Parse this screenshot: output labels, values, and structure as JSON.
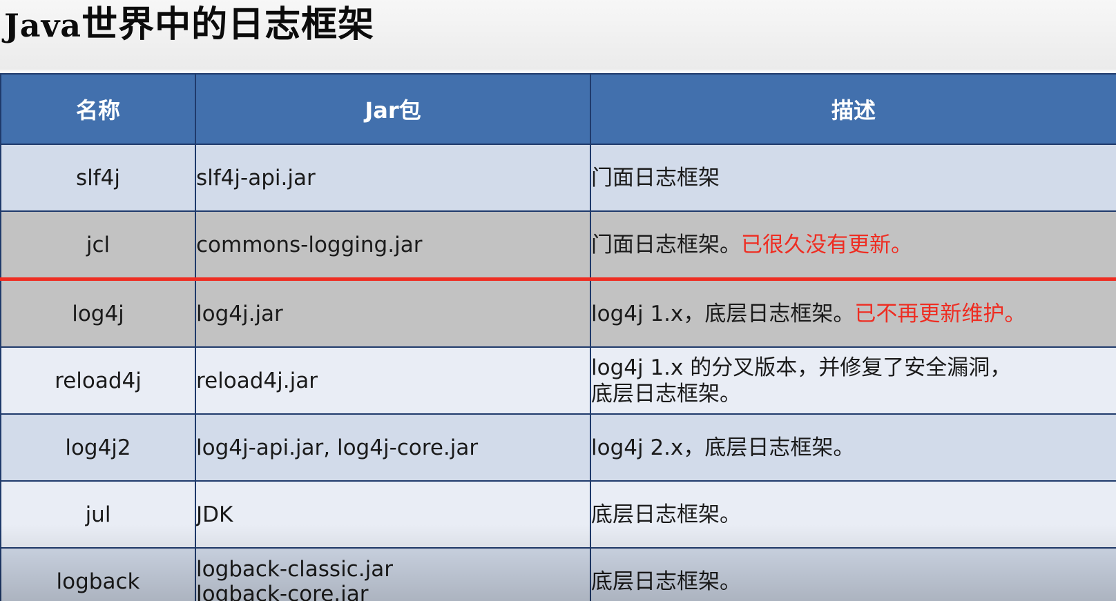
{
  "title": {
    "latin": "Java",
    "cjk": "世界中的日志框架"
  },
  "header": {
    "col_name": "名称",
    "col_jar": "Jar包",
    "col_desc": "描述"
  },
  "rows": [
    {
      "name": "slf4j",
      "jar": "slf4j-api.jar",
      "desc": "门面日志框架",
      "desc_red": ""
    },
    {
      "name": "jcl",
      "jar": "commons-logging.jar",
      "desc": "门面日志框架。",
      "desc_red": "已很久没有更新。"
    },
    {
      "name": "log4j",
      "jar": "log4j.jar",
      "desc": "log4j 1.x，底层日志框架。",
      "desc_red": "已不再更新维护。"
    },
    {
      "name": "reload4j",
      "jar": "reload4j.jar",
      "desc": "log4j 1.x 的分叉版本，并修复了安全漏洞，",
      "desc_line2": "底层日志框架。"
    },
    {
      "name": "log4j2",
      "jar": "log4j-api.jar, log4j-core.jar",
      "desc": "log4j 2.x，底层日志框架。"
    },
    {
      "name": "jul",
      "jar": "JDK",
      "desc": "底层日志框架。"
    },
    {
      "name": "logback",
      "jar": "logback-classic.jar",
      "jar_line2": "logback-core.jar",
      "desc": "底层日志框架。"
    }
  ],
  "colors": {
    "header_bg": "#4270ad",
    "border": "#1f3a6b",
    "highlight": "#ee2d22"
  }
}
